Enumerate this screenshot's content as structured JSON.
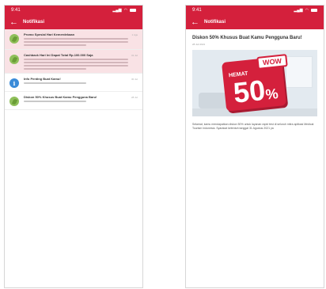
{
  "colors": {
    "brand": "#d4203c",
    "unread_bg": "#f9e2e5",
    "info_icon": "#3a8bd8",
    "leaf_icon": "#8fbf5a"
  },
  "left_screen": {
    "status_time": "9:41",
    "title": "Notifikasi",
    "notifications": [
      {
        "title": "Promo Spesial Hari Kemerdekaan",
        "date": "1 Ags",
        "icon": "leaf-icon",
        "unread": true,
        "lines": 3
      },
      {
        "title": "Cashback Hari Ini Dapat Total Rp.100.000 Saja",
        "date": "31 Jul",
        "icon": "leaf-icon",
        "unread": true,
        "lines": 4
      },
      {
        "title": "Info Penting Buat Kamu!",
        "date": "30 Jul",
        "icon": "info-icon",
        "unread": false,
        "lines": 1
      },
      {
        "title": "Diskon 50% Khusus Buat Kamu Pengguna Baru!",
        "date": "28 Jul",
        "icon": "leaf-icon",
        "unread": false,
        "lines": 1
      }
    ]
  },
  "right_screen": {
    "status_time": "9:41",
    "title": "Notifikasi",
    "detail_title": "Diskon 50% Khusus Buat Kamu Pengguna Baru!",
    "detail_date": "28 Juli 2021",
    "banner": {
      "tag": "HEMAT",
      "badge": "WOW",
      "big": "50",
      "percent": "%"
    },
    "detail_text": "Selamat, kamu mendapatkan diskon 50% untuk layanan rapid test di seluruh mitra aplikasi Medical Tourism Indonesia. Syarakat ketentuh tanggal 31 Agustus 2021 ya"
  }
}
